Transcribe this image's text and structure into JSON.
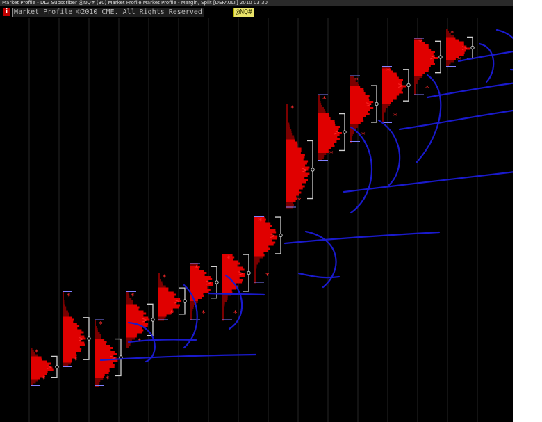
{
  "window": {
    "title": "Market Profile - DLV Subscriber @NQ# (30) Market Profile Market Profile - Margin, Split [DEFAULT] 2010 03 30"
  },
  "header": {
    "info_icon_label": "i",
    "copyright": "Market Profile ©2010 CME. All Rights Reserved",
    "symbol": "@NQ#"
  },
  "chart_data": {
    "type": "market-profile",
    "sessions": [
      {
        "index": 0,
        "low": 1,
        "high": 5,
        "poc": 3
      },
      {
        "index": 1,
        "low": 3,
        "high": 11,
        "poc": 6
      },
      {
        "index": 2,
        "low": 1,
        "high": 8,
        "poc": 4
      },
      {
        "index": 3,
        "low": 5,
        "high": 11,
        "poc": 8
      },
      {
        "index": 4,
        "low": 8,
        "high": 13,
        "poc": 10
      },
      {
        "index": 5,
        "low": 8,
        "high": 14,
        "poc": 12
      },
      {
        "index": 6,
        "low": 8,
        "high": 15,
        "poc": 13
      },
      {
        "index": 7,
        "low": 12,
        "high": 19,
        "poc": 17
      },
      {
        "index": 8,
        "low": 20,
        "high": 31,
        "poc": 24
      },
      {
        "index": 9,
        "low": 25,
        "high": 32,
        "poc": 28
      },
      {
        "index": 10,
        "low": 27,
        "high": 34,
        "poc": 31
      },
      {
        "index": 11,
        "low": 29,
        "high": 35,
        "poc": 33
      },
      {
        "index": 12,
        "low": 32,
        "high": 38,
        "poc": 36
      },
      {
        "index": 13,
        "low": 35,
        "high": 39,
        "poc": 37
      }
    ],
    "grid": true
  },
  "colors": {
    "background": "#000000",
    "profile": "#e00000",
    "profile_dark": "#7a0000",
    "value_area": "#d0d0d0",
    "annotation": "#1a1acc",
    "marker": "#ff2a2a"
  }
}
